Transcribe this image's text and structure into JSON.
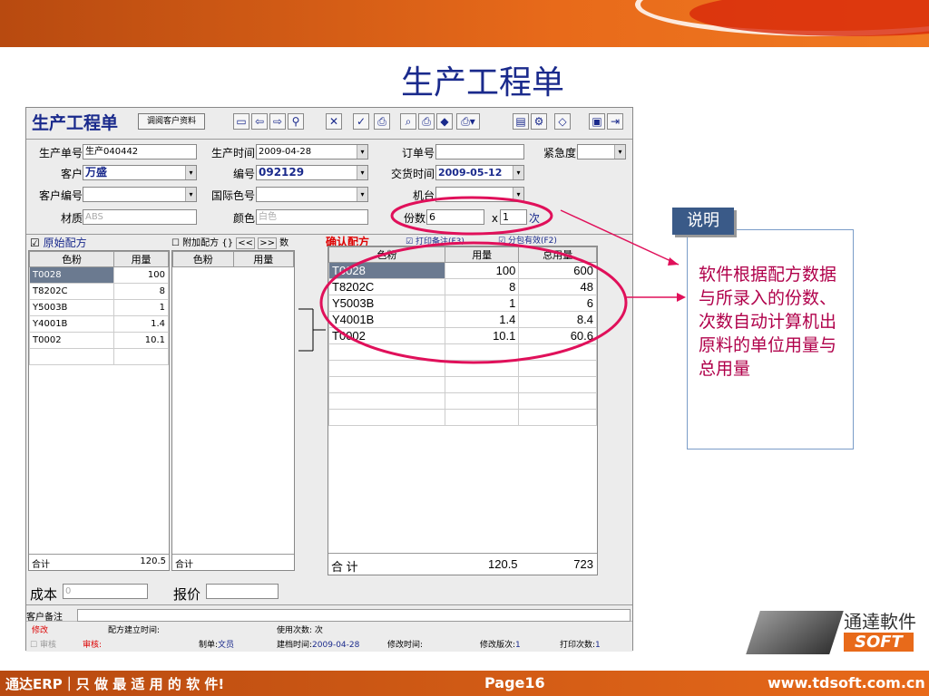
{
  "slide_title": "生产工程单",
  "app": {
    "title": "生产工程单",
    "customer_btn": "调阅客户资料"
  },
  "form": {
    "order_no_label": "生产单号",
    "order_no": "生产040442",
    "prod_time_label": "生产时间",
    "prod_time": "2009-04-28",
    "po_label": "订单号",
    "po": "",
    "urgency_label": "紧急度",
    "urgency": "",
    "customer_label": "客户",
    "customer": "万盛",
    "code_label": "编号",
    "code": "092129",
    "delivery_label": "交货时间",
    "delivery": "2009-05-12",
    "cust_code_label": "客户编号",
    "cust_code": "",
    "intl_color_label": "国际色号",
    "intl_color": "",
    "machine_label": "机台",
    "machine": "",
    "material_label": "材质",
    "material": "ABS",
    "color_label": "颜色",
    "color": "白色",
    "copies_label": "份数",
    "copies": "6",
    "x_label": "x",
    "times": "1",
    "times_unit": "次"
  },
  "original": {
    "title": "原始配方",
    "col_powder": "色粉",
    "col_amount": "用量",
    "rows": [
      [
        "T0028",
        "100"
      ],
      [
        "T8202C",
        "8"
      ],
      [
        "Y5003B",
        "1"
      ],
      [
        "Y4001B",
        "1.4"
      ],
      [
        "T0002",
        "10.1"
      ]
    ],
    "total_label": "合计",
    "total": "120.5"
  },
  "extra": {
    "title": "附加配方",
    "col_powder": "色粉",
    "col_amount": "用量",
    "nav1": "<<",
    "nav2": ">>",
    "braces": "{}",
    "num": "数",
    "total_label": "合计"
  },
  "confirm": {
    "title": "确认配方",
    "print_note": "打印备注(F3)",
    "pack_valid": "分包有效(F2)",
    "col_powder": "色粉",
    "col_amount": "用量",
    "col_total": "总用量",
    "rows": [
      [
        "T0028",
        "100",
        "600"
      ],
      [
        "T8202C",
        "8",
        "48"
      ],
      [
        "Y5003B",
        "1",
        "6"
      ],
      [
        "Y4001B",
        "1.4",
        "8.4"
      ],
      [
        "T0002",
        "10.1",
        "60.6"
      ]
    ],
    "total_label": "合 计",
    "total_amount": "120.5",
    "total_sum": "723"
  },
  "cost": {
    "cost_label": "成本",
    "cost_value": "0",
    "quote_label": "报价"
  },
  "footer": {
    "note_label": "客户备注",
    "modify": "修改",
    "created_time_label": "配方建立时间:",
    "use_count_label": "使用次数:",
    "use_count_unit": "次",
    "audit": "审核",
    "audit_red": "审核:",
    "maker_label": "制单:",
    "maker": "文员",
    "archive_label": "建档时间:",
    "archive": "2009-04-28",
    "modify_time_label": "修改时间:",
    "version_label": "修改版次:",
    "version": "1",
    "print_count_label": "打印次数:",
    "print_count": "1"
  },
  "explain": {
    "tag": "说明",
    "text": "软件根据配方数据与所录入的份数、次数自动计算机出原料的单位用量与总用量"
  },
  "bottom": {
    "left": "通达ERP｜只 做 最 适 用 的 软 件!",
    "page": "Page16",
    "url": "www.tdsoft.com.cn"
  },
  "logo": {
    "cn": "通達軟件",
    "en": "SOFT"
  },
  "colors": {
    "accent": "#e86a1a",
    "title_blue": "#1a2a8c",
    "highlight": "#e0105a"
  }
}
